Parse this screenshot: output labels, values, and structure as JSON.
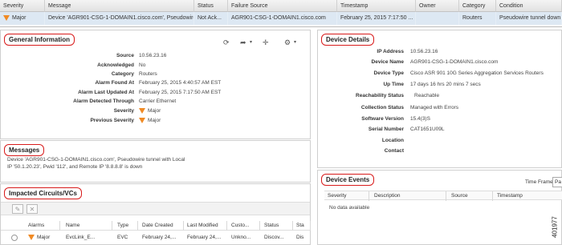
{
  "alarm_table": {
    "columns": [
      "Severity",
      "Message",
      "Status",
      "Failure Source",
      "Timestamp",
      "Owner",
      "Category",
      "Condition"
    ],
    "row": {
      "severity": "Major",
      "message": "Device 'AGR901-CSG-1-DOMAIN1.cisco.com', Pseudowire tunnel w...",
      "status": "Not Ack...",
      "failure_source": "AGR901-CSG-1-DOMAIN1.cisco.com",
      "timestamp": "February 25, 2015 7:17:50 ...",
      "owner": "",
      "category": "Routers",
      "condition": "Pseudowire tunnel down"
    }
  },
  "general": {
    "title": "General Information",
    "fields": [
      {
        "label": "Source",
        "value": "10.56.23.16"
      },
      {
        "label": "Acknowledged",
        "value": "No"
      },
      {
        "label": "Category",
        "value": "Routers"
      },
      {
        "label": "Alarm Found At",
        "value": "February 25, 2015 4:40:57 AM EST"
      },
      {
        "label": "Alarm Last Updated At",
        "value": "February 25, 2015 7:17:50 AM EST"
      },
      {
        "label": "Alarm Detected Through",
        "value": "Carrier Ethernet"
      },
      {
        "label": "Severity",
        "value": "Major"
      },
      {
        "label": "Previous Severity",
        "value": "Major"
      }
    ]
  },
  "messages": {
    "title": "Messages",
    "line1": "Device 'AGR901-CSG-1-DOMAIN1.cisco.com', Pseudowire tunnel with Local",
    "line2": "IP '50.1.20.23', Pwid '112', and Remote IP '8.8.8.8' is down"
  },
  "circuits": {
    "title": "Impacted Circuits/VCs",
    "columns": [
      "Alarms",
      "Name",
      "Type",
      "Date Created",
      "Last Modified",
      "Custo...",
      "Status",
      "Sta"
    ],
    "row": {
      "alarms": "Major",
      "name": "EvcLink_E...",
      "type": "EVC",
      "created": "February 24,...",
      "modified": "February 24,...",
      "customer": "Unkno...",
      "status": "Discov...",
      "sta": "Dis"
    }
  },
  "device": {
    "title": "Device Details",
    "fields": [
      {
        "label": "IP Address",
        "value": "10.56.23.16"
      },
      {
        "label": "Device Name",
        "value": "AGR901-CSG-1-DOMAIN1.cisco.com"
      },
      {
        "label": "Device Type",
        "value": "Cisco ASR 901 10G Series Aggregation Services Routers"
      },
      {
        "label": "Up Time",
        "value": "17 days 16 hrs 20 mins 7 secs"
      },
      {
        "label": "Reachability Status",
        "value": "Reachable"
      },
      {
        "label": "Collection Status",
        "value": "Managed with Errors"
      },
      {
        "label": "Software Version",
        "value": "15.4(3)S"
      },
      {
        "label": "Serial Number",
        "value": "CAT1651U09L"
      },
      {
        "label": "Location",
        "value": ""
      },
      {
        "label": "Contact",
        "value": ""
      }
    ]
  },
  "events": {
    "title": "Device Events",
    "time_frame_label": "Time Frame",
    "time_frame_value": "Pa",
    "columns": [
      "Severity",
      "Description",
      "Source",
      "Timestamp"
    ],
    "empty": "No data available"
  },
  "figure_id": "401977",
  "colors": {
    "major": "#f08a24",
    "highlight": "#dde8f3",
    "annotation": "#d81b1b"
  }
}
